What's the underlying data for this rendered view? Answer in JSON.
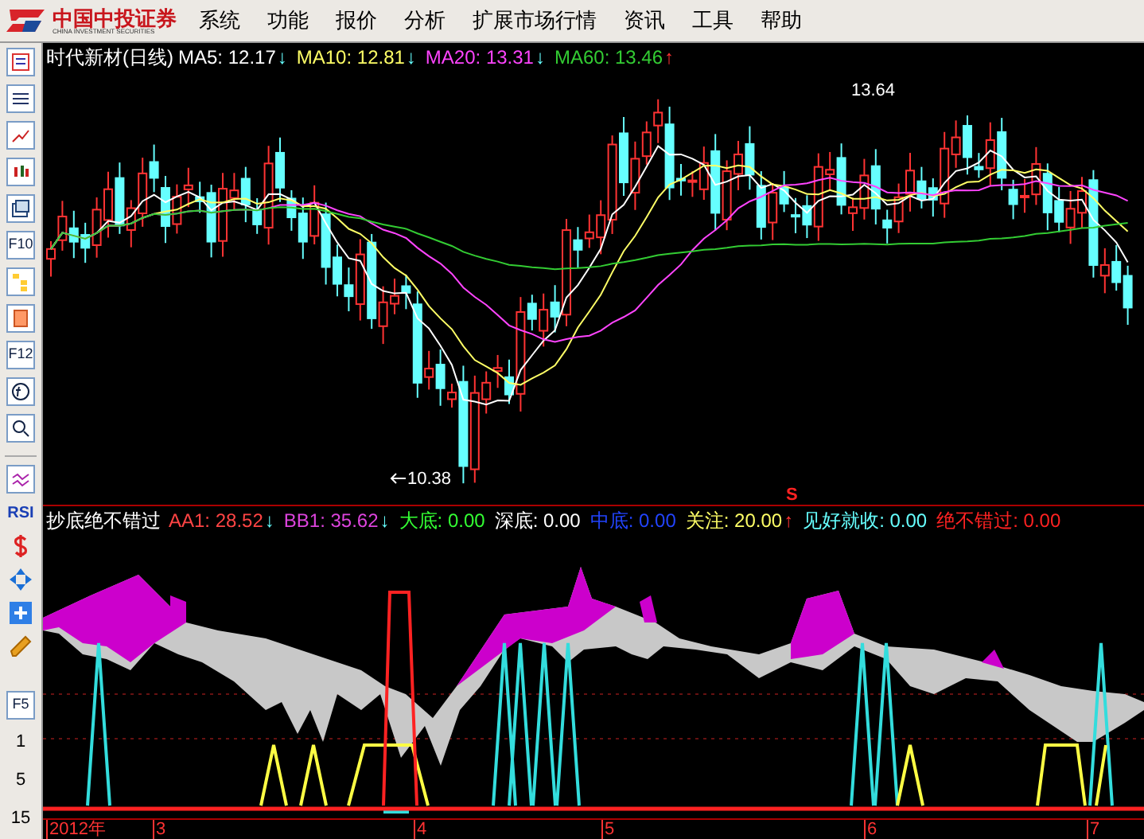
{
  "menu": {
    "logo_text": "中国中投证券",
    "logo_subtext": "CHINA INVESTMENT SECURITIES",
    "items": [
      "系统",
      "功能",
      "报价",
      "分析",
      "扩展市场行情",
      "资讯",
      "工具",
      "帮助"
    ]
  },
  "toolbar": {
    "labels": [
      "F10",
      "F12",
      "RSI",
      "F5"
    ],
    "scale": [
      "1",
      "5",
      "15"
    ]
  },
  "price_panel": {
    "title": "时代新材(日线)",
    "indicators": [
      {
        "text": "MA5: 12.17",
        "arrow": "↓",
        "rising": false,
        "color": "#ffffff"
      },
      {
        "text": "MA10: 12.81",
        "arrow": "↓",
        "rising": false,
        "color": "#ffff66"
      },
      {
        "text": "MA20: 13.31",
        "arrow": "↓",
        "rising": false,
        "color": "#ff44ff"
      },
      {
        "text": "MA60: 13.46",
        "arrow": "↑",
        "rising": true,
        "color": "#33cc33"
      }
    ],
    "high_label": "13.64",
    "low_label": "10.38"
  },
  "marker": "S",
  "indicator_panel": {
    "title": "抄底绝不错过",
    "indicators": [
      {
        "text": "AA1: 28.52",
        "arrow": "↓",
        "rising": false,
        "color": "#ff4444"
      },
      {
        "text": "BB1: 35.62",
        "arrow": "↓",
        "rising": false,
        "color": "#dd44dd"
      },
      {
        "text": "大底: 0.00",
        "color": "#33ff33"
      },
      {
        "text": "深底: 0.00",
        "color": "#ffffff"
      },
      {
        "text": "中底: 0.00",
        "color": "#2244ff"
      },
      {
        "text": "关注: 20.00",
        "arrow": "↑",
        "rising": true,
        "color": "#ffff66"
      },
      {
        "text": "见好就收: 0.00",
        "color": "#66ffff"
      },
      {
        "text": "绝不错过: 0.00",
        "color": "#ff2222"
      }
    ]
  },
  "dates": [
    "2012年",
    "3",
    "4",
    "5",
    "6",
    "7"
  ]
}
